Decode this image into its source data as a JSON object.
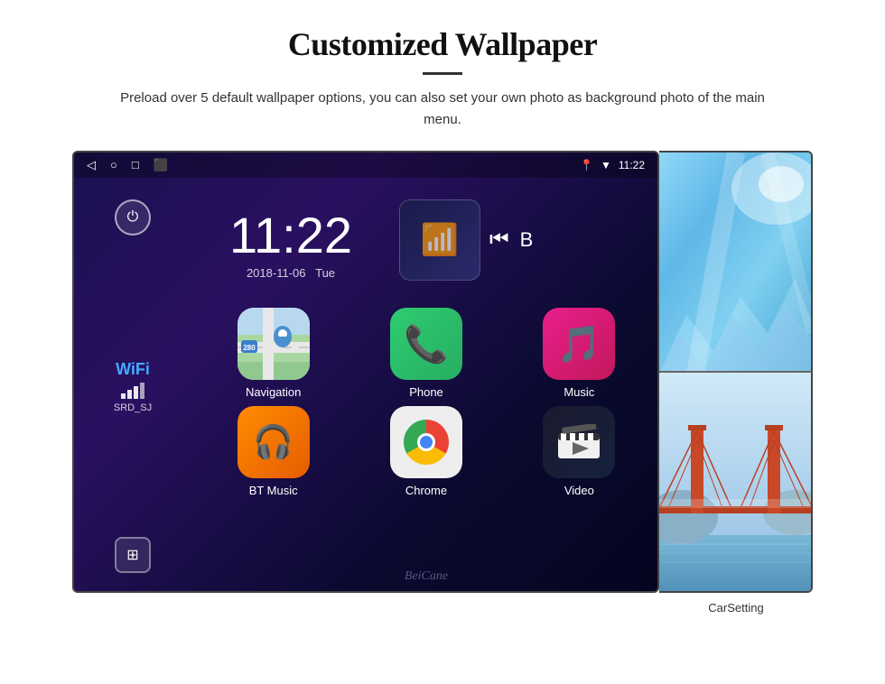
{
  "page": {
    "title": "Customized Wallpaper",
    "subtitle": "Preload over 5 default wallpaper options, you can also set your own photo as background photo of the main menu.",
    "divider": "—"
  },
  "statusbar": {
    "time": "11:22",
    "icons": [
      "◁",
      "○",
      "□",
      "⬛"
    ],
    "right_icons": [
      "📍",
      "▼"
    ],
    "signal": "▲"
  },
  "clock": {
    "time": "11:22",
    "date": "2018-11-06",
    "day": "Tue"
  },
  "wifi": {
    "label": "WiFi",
    "ssid": "SRD_SJ"
  },
  "apps": [
    {
      "label": "Navigation",
      "id": "navigation"
    },
    {
      "label": "Phone",
      "id": "phone"
    },
    {
      "label": "Music",
      "id": "music"
    },
    {
      "label": "BT Music",
      "id": "btmusic"
    },
    {
      "label": "Chrome",
      "id": "chrome"
    },
    {
      "label": "Video",
      "id": "video"
    }
  ],
  "media": {
    "prev_icon": "⏮",
    "label": "B"
  },
  "sidebar": {
    "power_icon": "⏻",
    "menu_icon": "⊞"
  },
  "map": {
    "road_label": "280",
    "nav_label": "Navigation"
  },
  "watermark": "BeiCane",
  "fourth_app": {
    "label": "CarSetting"
  }
}
